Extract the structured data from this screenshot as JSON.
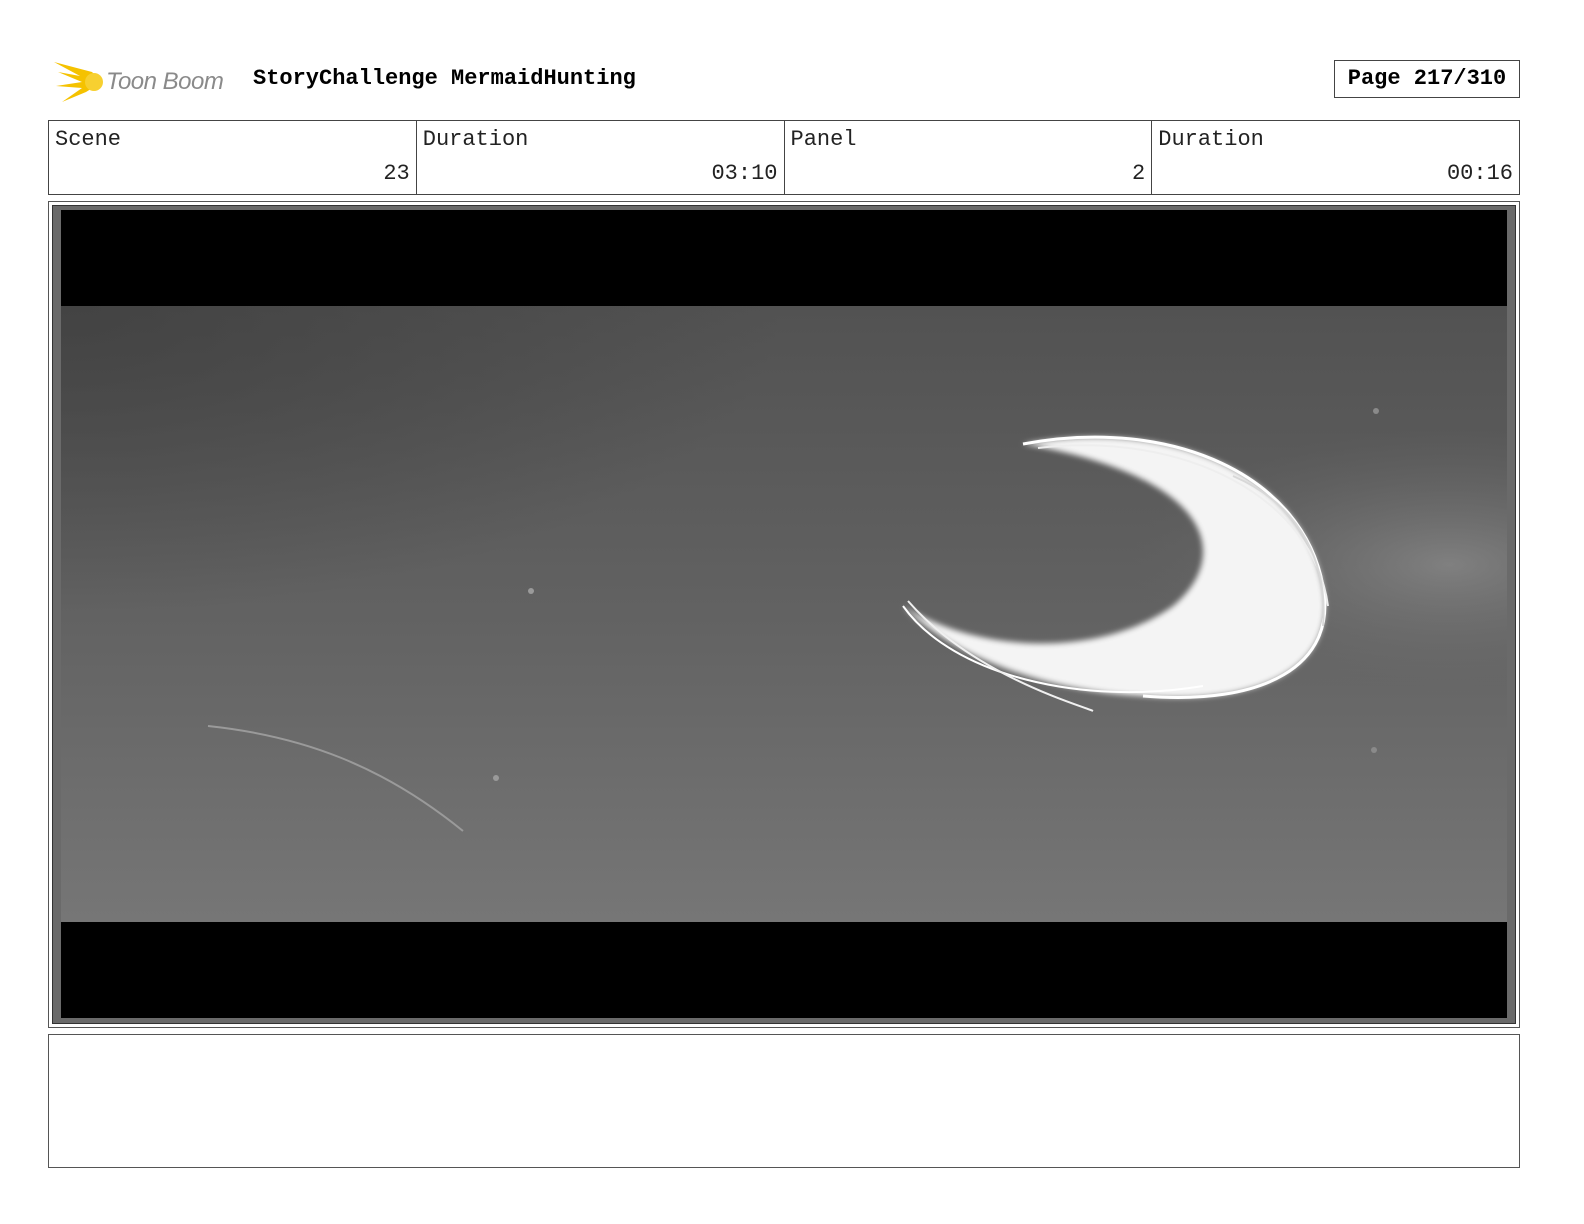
{
  "header": {
    "logo_text": "Toon Boom",
    "project_title": "StoryChallenge MermaidHunting",
    "page_label": "Page 217/310"
  },
  "info": [
    {
      "label": "Scene",
      "value": "23"
    },
    {
      "label": "Duration",
      "value": "03:10"
    },
    {
      "label": "Panel",
      "value": "2"
    },
    {
      "label": "Duration",
      "value": "00:16"
    }
  ],
  "panel": {
    "description": "",
    "icon": "toon-boom-logo-icon"
  },
  "notes": {
    "text": ""
  },
  "colors": {
    "logo_yellow": "#f5c200",
    "letterbox": "#000000",
    "sky": "#6a6a6a"
  }
}
